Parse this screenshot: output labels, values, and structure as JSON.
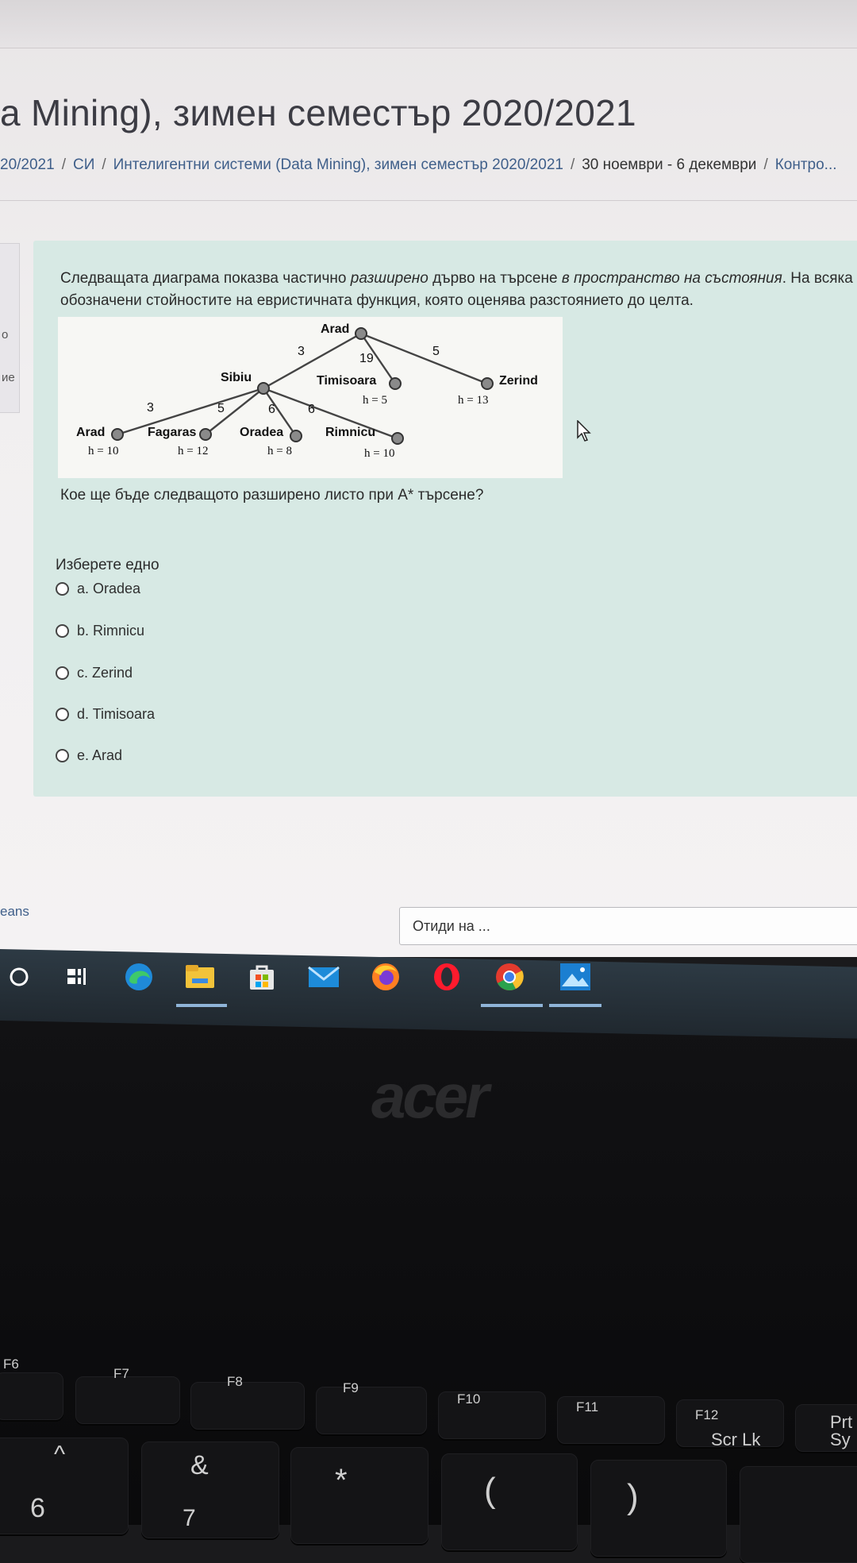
{
  "page": {
    "course_title": "a Mining), зимен семестър 2020/2021",
    "breadcrumb": [
      "20/2021",
      "СИ",
      "Интелигентни системи (Data Mining), зимен семестър 2020/2021",
      "30 ноември - 6 декември",
      "Контро..."
    ],
    "sidebar": {
      "item1": "о",
      "item2": "ие"
    }
  },
  "question": {
    "intro_part1": "Следващата диаграма показва частично ",
    "intro_em1": "разширено",
    "intro_part2": " дърво на търсене ",
    "intro_em2": "в пространство на състояния",
    "intro_part3": ". На всяка",
    "intro_line2": "обозначени стойностите на евристичната функция, която оценява разстоянието до целта.",
    "prompt": "Кое ще бъде следващото разширено листо при A* търсене?",
    "choose_label": "Изберете едно",
    "options": [
      {
        "label": "a. Oradea"
      },
      {
        "label": "b. Rimnicu"
      },
      {
        "label": "c. Zerind"
      },
      {
        "label": "d. Timisoara"
      },
      {
        "label": "e. Arad"
      }
    ]
  },
  "diagram": {
    "nodes": {
      "root": "Arad",
      "sibiu": "Sibiu",
      "timisoara": "Timisoara",
      "zerind": "Zerind",
      "arad2": "Arad",
      "fagaras": "Fagaras",
      "oradea": "Oradea",
      "rimnicu": "Rimnicu"
    },
    "edges": {
      "root_sibiu": "3",
      "root_timisoara": "19",
      "root_zerind": "5",
      "sibiu_arad": "3",
      "sibiu_fagaras": "5",
      "sibiu_oradea": "6",
      "sibiu_rimnicu": "6"
    },
    "heuristics": {
      "timisoara": "h = 5",
      "zerind": "h = 13",
      "arad": "h = 10",
      "fagaras": "h = 12",
      "oradea": "h = 8",
      "rimnicu": "h = 10"
    }
  },
  "footer": {
    "link_text": "eans",
    "goto_placeholder": "Отиди на ..."
  },
  "taskbar": {
    "icons": [
      "cortana-circle",
      "task-view",
      "edge",
      "file-explorer",
      "store",
      "mail",
      "firefox",
      "opera",
      "chrome",
      "photos"
    ]
  },
  "laptop": {
    "brand": "acer",
    "keys": {
      "f6": "F6",
      "f7": "F7",
      "f8": "F8",
      "f9": "F9",
      "f10": "F10",
      "f11": "F11",
      "f12": "F12",
      "scrlk": "Scr Lk",
      "prtsc": "Prt Sy",
      "num6_top": "^",
      "num6": "6",
      "num7_top": "&",
      "num7": "7",
      "num8_top": "*",
      "paren_open": "(",
      "paren_close": ")"
    }
  },
  "colors": {
    "question_bg": "#d7e9e4",
    "link": "#3f5f8a",
    "taskbar": "#25303a"
  }
}
